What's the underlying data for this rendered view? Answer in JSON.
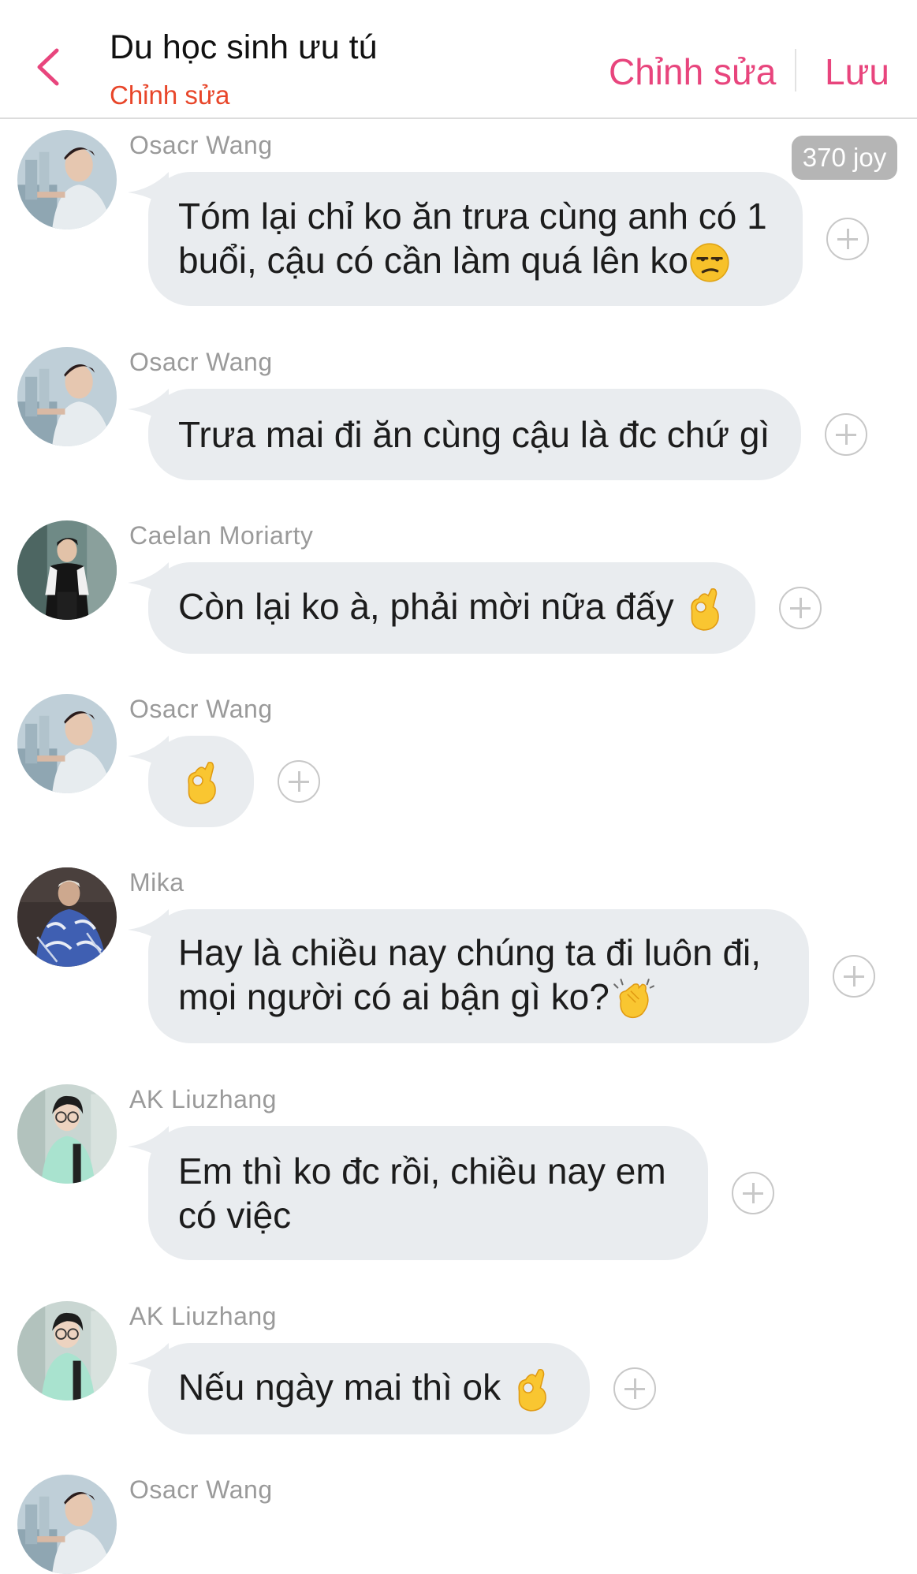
{
  "header": {
    "title": "Du học sinh ưu tú",
    "subtitle": "Chỉnh sửa",
    "edit_label": "Chỉnh sửa",
    "save_label": "Lưu",
    "accent_color": "#e8457d",
    "subtitle_color": "#e8462a"
  },
  "badge": {
    "text": "370 joy"
  },
  "messages": [
    {
      "sender": "Osacr Wang",
      "text": "Tóm lại chỉ ko ăn trưa cùng anh có 1 buổi, cậu có cần làm quá lên ko",
      "emoji": "unamused-face-icon"
    },
    {
      "sender": "Osacr Wang",
      "text": "Trưa mai đi ăn cùng cậu là đc chứ gì"
    },
    {
      "sender": "Caelan Moriarty",
      "text": "Còn lại ko à, phải mời nữa đấy",
      "emoji": "ok-hand-icon"
    },
    {
      "sender": "Osacr Wang",
      "text": "",
      "emoji": "ok-hand-icon"
    },
    {
      "sender": "Mika",
      "text": "Hay là chiều nay chúng ta đi luôn đi, mọi người có ai bận gì ko?",
      "emoji": "clapping-hands-icon"
    },
    {
      "sender": "AK Liuzhang",
      "text": "Em thì ko đc rồi, chiều nay em có việc"
    },
    {
      "sender": "AK Liuzhang",
      "text": "Nếu ngày mai thì ok",
      "emoji": "ok-hand-icon"
    },
    {
      "sender": "Osacr Wang"
    }
  ]
}
